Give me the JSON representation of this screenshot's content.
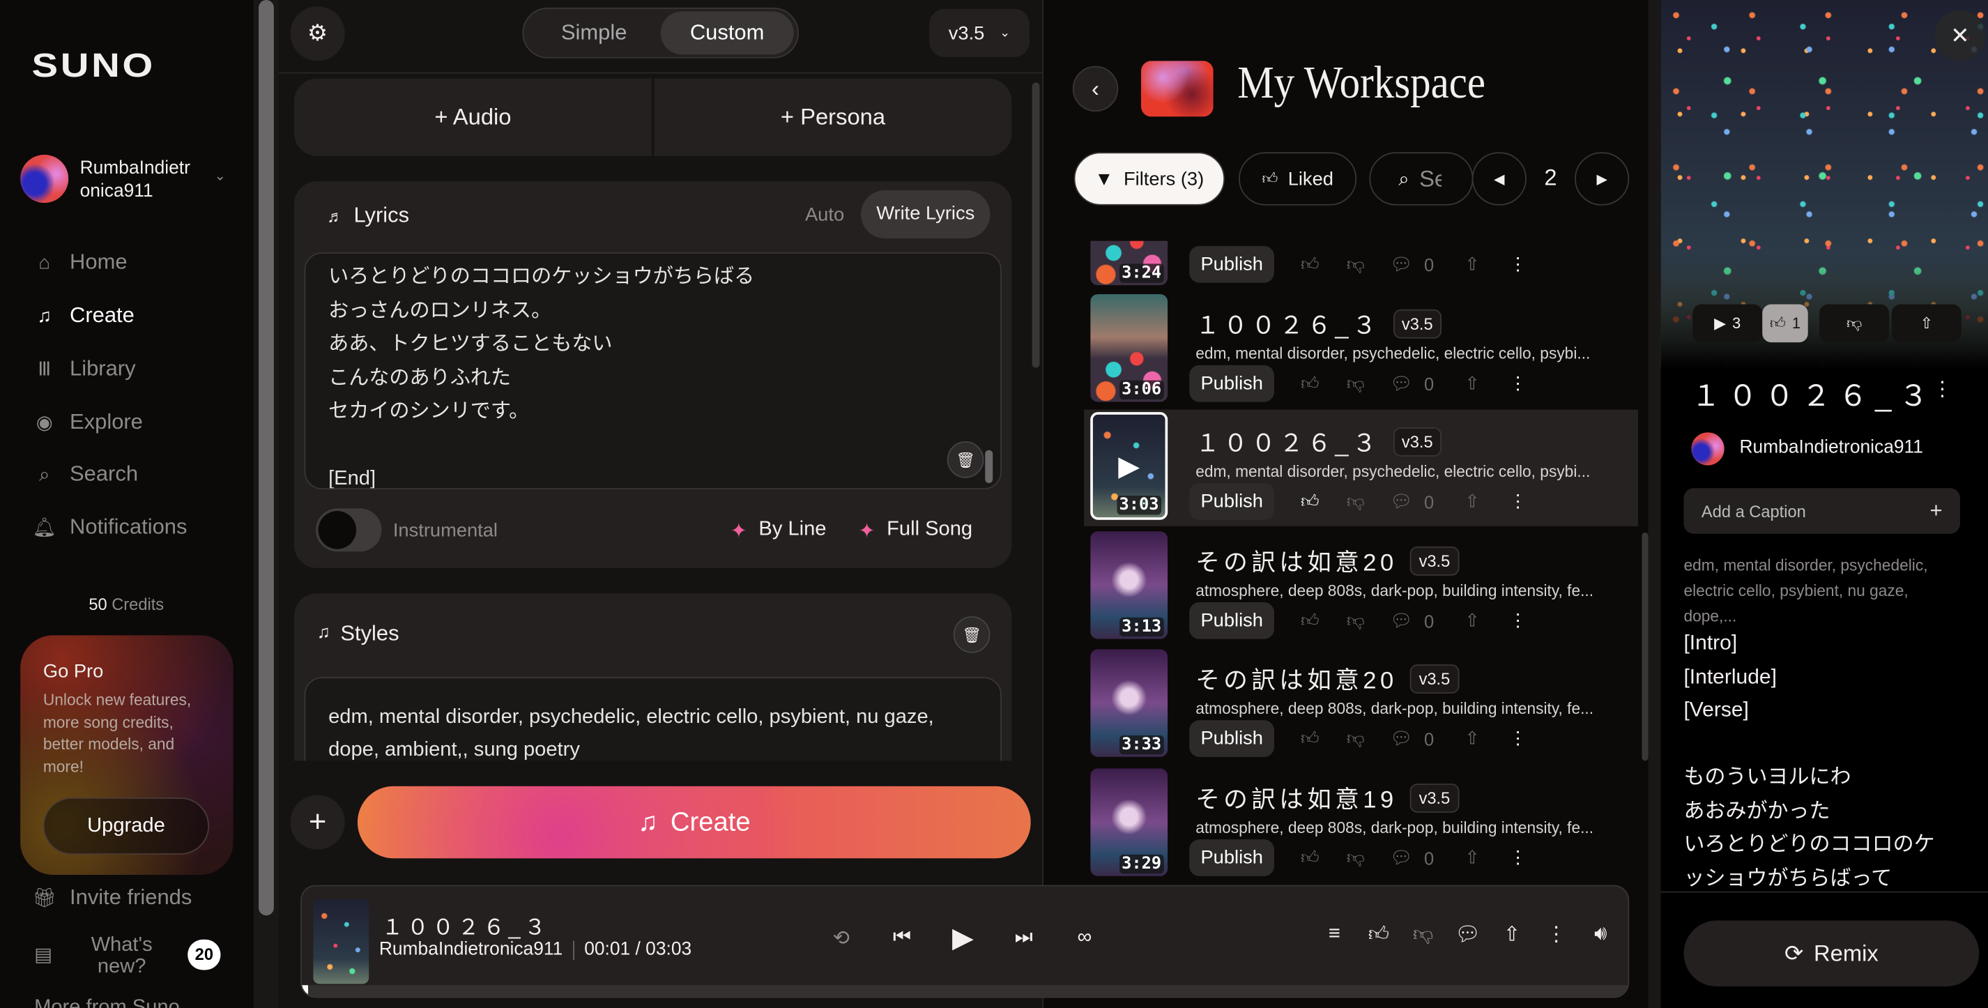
{
  "sidebar": {
    "logo": "SUNO",
    "username": "RumbaIndietr\nonica911",
    "nav": [
      {
        "label": "Home",
        "icon": "home-icon"
      },
      {
        "label": "Create",
        "icon": "create-icon"
      },
      {
        "label": "Library",
        "icon": "library-icon"
      },
      {
        "label": "Explore",
        "icon": "explore-icon"
      },
      {
        "label": "Search",
        "icon": "search-icon"
      },
      {
        "label": "Notifications",
        "icon": "bell-icon"
      }
    ],
    "credits_num": "50",
    "credits_label": "Credits",
    "gopro": {
      "title": "Go Pro",
      "text": "Unlock new features, more song credits, better models, and more!",
      "button": "Upgrade"
    },
    "invite": "Invite friends",
    "whats_new": "What's new?",
    "whats_new_badge": "20",
    "more": "More from Suno"
  },
  "create": {
    "mode_simple": "Simple",
    "mode_custom": "Custom",
    "model": "v3.5",
    "audio": "+ Audio",
    "persona": "+ Persona",
    "lyrics_title": "Lyrics",
    "lyrics_auto": "Auto",
    "lyrics_write": "Write Lyrics",
    "lyrics_text": "いろとりどりのココロのケッショウがちらばる\nおっさんのロンリネス。\nああ、トクヒツすることもない\nこんなのありふれた\nセカイのシンリです。\n\n[End]",
    "instrumental": "Instrumental",
    "by_line": "By Line",
    "full_song": "Full Song",
    "styles_title": "Styles",
    "styles_text": "edm, mental disorder, psychedelic, electric cello, psybient, nu gaze, dope, ambient,, sung poetry",
    "create_button": "Create"
  },
  "workspace": {
    "title": "My Workspace",
    "filters": "Filters (3)",
    "liked": "Liked",
    "search_placeholder": "Search",
    "page": "2",
    "publish": "Publish",
    "comments": "0",
    "songs": [
      {
        "title": "",
        "version": "",
        "tags": "",
        "duration": "3:24"
      },
      {
        "title": "１００２６_３",
        "version": "v3.5",
        "tags": "edm, mental disorder, psychedelic, electric cello, psybi...",
        "duration": "3:06"
      },
      {
        "title": "１００２６_３",
        "version": "v3.5",
        "tags": "edm, mental disorder, psychedelic, electric cello, psybi...",
        "duration": "3:03"
      },
      {
        "title": "その訳は如意20",
        "version": "v3.5",
        "tags": "atmosphere, deep 808s, dark-pop, building intensity, fe...",
        "duration": "3:13"
      },
      {
        "title": "その訳は如意20",
        "version": "v3.5",
        "tags": "atmosphere, deep 808s, dark-pop, building intensity, fe...",
        "duration": "3:33"
      },
      {
        "title": "その訳は如意19",
        "version": "v3.5",
        "tags": "atmosphere, deep 808s, dark-pop, building intensity, fe...",
        "duration": "3:29"
      }
    ]
  },
  "player": {
    "title": "１００２６_３",
    "artist": "RumbaIndietronica911",
    "time": "00:01 / 03:03",
    "progress": 0.005
  },
  "detail": {
    "plays": "3",
    "likes": "1",
    "title": "１００２６_３",
    "artist": "RumbaIndietronica911",
    "caption_placeholder": "Add a Caption",
    "tags": "edm, mental disorder, psychedelic, electric cello, psybient, nu gaze, dope,...",
    "lyrics": "[Intro]\n[Interlude]\n[Verse]\n\nものういヨルにわ\nあおみがかった\nいろとりどりのココロのケ\nッショウがちらばって",
    "remix": "Remix"
  }
}
